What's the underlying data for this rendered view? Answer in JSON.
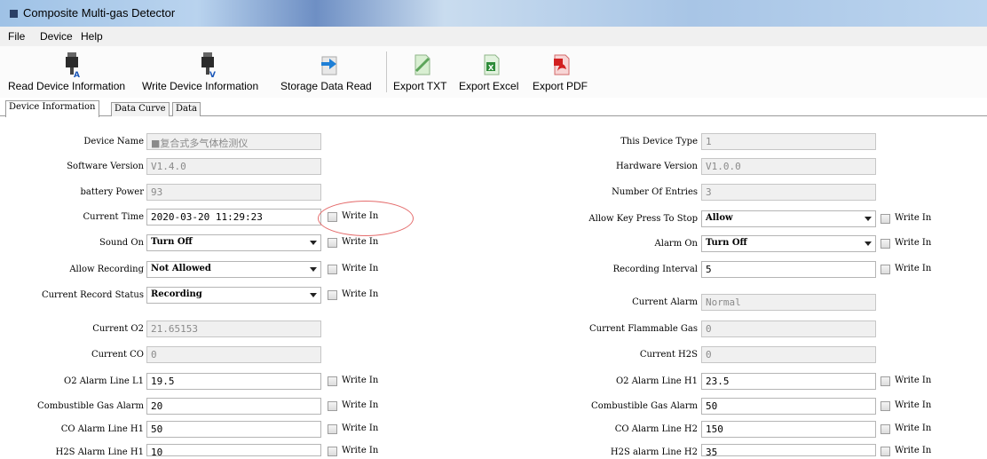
{
  "window": {
    "title": "Composite Multi-gas Detector"
  },
  "menu": [
    "File",
    "Device",
    "Help"
  ],
  "toolbar": {
    "read_device": "Read Device Information",
    "write_device": "Write Device Information",
    "storage_read": "Storage Data Read",
    "export_txt": "Export TXT",
    "export_excel": "Export Excel",
    "export_pdf": "Export PDF"
  },
  "tabs": [
    "Device Information",
    "Data Curve",
    "Data"
  ],
  "write_in": "Write In",
  "left": {
    "device_name": {
      "label": "Device Name",
      "value": "■复合式多气体检测仪"
    },
    "software_version": {
      "label": "Software Version",
      "value": "V1.4.0"
    },
    "battery_power": {
      "label": "battery Power",
      "value": "93"
    },
    "current_time": {
      "label": "Current Time",
      "value": "2020-03-20 11:29:23"
    },
    "sound_on": {
      "label": "Sound On",
      "value": "Turn Off"
    },
    "allow_recording": {
      "label": "Allow Recording",
      "value": "Not Allowed"
    },
    "record_status": {
      "label": "Current Record Status",
      "value": "Recording"
    },
    "current_o2": {
      "label": "Current O2",
      "value": "21.65153"
    },
    "current_co": {
      "label": "Current CO",
      "value": "0"
    },
    "o2_alarm_l1": {
      "label": "O2 Alarm Line L1",
      "value": "19.5"
    },
    "comb_gas_alarm": {
      "label": "Combustible Gas Alarm",
      "value": "20"
    },
    "co_alarm_h1": {
      "label": "CO Alarm Line H1",
      "value": "50"
    },
    "h2s_alarm_h1": {
      "label": "H2S Alarm Line H1",
      "value": "10"
    }
  },
  "right": {
    "device_type": {
      "label": "This Device Type",
      "value": "1"
    },
    "hardware_version": {
      "label": "Hardware Version",
      "value": "V1.0.0"
    },
    "num_entries": {
      "label": "Number Of Entries",
      "value": "3"
    },
    "key_press_stop": {
      "label": "Allow Key Press To Stop",
      "value": "Allow"
    },
    "alarm_on": {
      "label": "Alarm On",
      "value": "Turn Off"
    },
    "recording_interval": {
      "label": "Recording Interval",
      "value": "5"
    },
    "current_alarm": {
      "label": "Current Alarm",
      "value": "Normal"
    },
    "flammable_gas": {
      "label": "Current Flammable Gas",
      "value": "0"
    },
    "current_h2s": {
      "label": "Current H2S",
      "value": "0"
    },
    "o2_alarm_h1": {
      "label": "O2 Alarm Line H1",
      "value": "23.5"
    },
    "comb_gas_alarm": {
      "label": "Combustible Gas Alarm",
      "value": "50"
    },
    "co_alarm_h2": {
      "label": "CO Alarm Line H2",
      "value": "150"
    },
    "h2s_alarm_h2": {
      "label": "H2S alarm Line H2",
      "value": "35"
    }
  }
}
